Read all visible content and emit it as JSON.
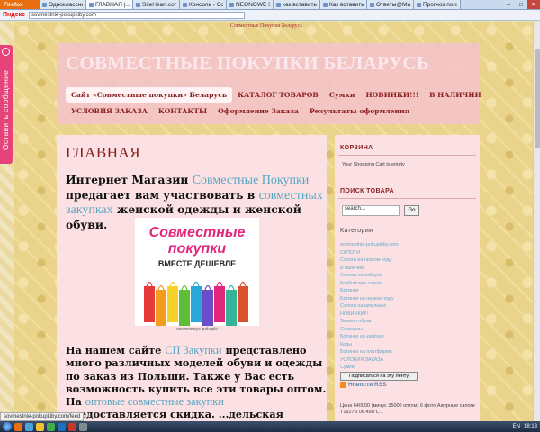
{
  "browser": {
    "firefox_label": "Firefox",
    "tabs": [
      {
        "label": "Одноклассники",
        "active": false
      },
      {
        "label": "ГЛАВНАЯ |...",
        "active": true
      },
      {
        "label": "SiteHeart.com",
        "active": false
      },
      {
        "label": "Консоль › Сов...",
        "active": false
      },
      {
        "label": "NEONOWE SZ...",
        "active": false
      },
      {
        "label": "как вставить к...",
        "active": false
      },
      {
        "label": "Как вставить к...",
        "active": false
      },
      {
        "label": "Ответы@Mail....",
        "active": false
      },
      {
        "label": "Прогноз пого...",
        "active": false
      }
    ],
    "yandex_label": "Яндекс",
    "url": "sovmestnie-pokupkiby.com",
    "window_buttons": [
      "–",
      "□",
      "✕"
    ],
    "status_url": "sovmestnie-pokupkiby.com/feed"
  },
  "share_widget": {
    "label": "Оставить сообщение",
    "icon": "chat-bubble-icon"
  },
  "site": {
    "top_line": "Совместные Покупки Беларусь",
    "title": "СОВМЕСТНЫЕ ПОКУПКИ БЕЛАРУСЬ",
    "menu_row1": [
      "Сайт «Совместные покупки» Беларусь",
      "КАТАЛОГ ТОВАРОВ",
      "Сумки",
      "НОВИНКИ!!!",
      "В НАЛИЧИИ"
    ],
    "menu_row2": [
      "УСЛОВИЯ ЗАКАЗА",
      "КОНТАКТЫ",
      "Оформление Заказа",
      "Результаты оформления"
    ]
  },
  "main": {
    "title": "ГЛАВНАЯ",
    "intro": {
      "t1": "Интернет Магазин ",
      "l1": "Совместные Покупки",
      "t2": " предагает вам участвовать в ",
      "l2": "совместных закупках",
      "t3": " женской одежды и женской обуви."
    },
    "promo": {
      "line1": "Совместные",
      "line2": "покупки",
      "line3": "ВМЕСТЕ ДЕШЕВЛЕ",
      "caption": "sovmestnye-pokupki",
      "bag_colors": [
        "#e63b3b",
        "#f39c1e",
        "#f5d32b",
        "#5cbf3a",
        "#2aa6d8",
        "#6a4fc7",
        "#e2267b",
        "#37b39a",
        "#d8532b"
      ]
    },
    "body": {
      "t1": "На нашем сайте ",
      "l1": "СП Закупки",
      "t2": " представлено много различных моделей обуви и одежды по заказ из Польши. Также у Вас есть возможность купить все эти товары оптом. На ",
      "l2": "оптовые совместные закупки",
      "t3": " предоставляется скидка. ...дельская Женская обувь, которую вы увидите"
    }
  },
  "sidebar": {
    "cart_title": "КОРЗИНА",
    "cart_text": "Your Shopping Cart is empty",
    "search_title": "ПОИСК ТОВАРА",
    "search_value": "search...",
    "search_button": "Go",
    "categories_title": "Категории",
    "categories": [
      "sovmestnie-pokupkiby.com",
      "САПОГИ",
      "Сапоги на низком ходу",
      "В наличии",
      "Сапоги на каблуке",
      "Ковбойские сапоги",
      "Ботинки",
      "Ботинки на низком ходу",
      "Сапоги на шпильках",
      "НОВИНКИ!!!",
      "Зимняя обувь",
      "Сникерсы",
      "Ботинки на каблуке",
      "Кеды",
      "Ботинки на платформе",
      "УСЛОВИЯ ЗАКАЗА",
      "Сумки"
    ],
    "subscribe_button": "Подписаться на эту ленту",
    "rss_title": "Новости RSS",
    "feed_text": "Цена 640000 (минус 35000 оптом) 6 фото Ажурные сапоги T1927B 06.49D L..."
  },
  "taskbar": {
    "lang": "EN",
    "time": "18:13",
    "icon_colors": [
      "#e96e0f",
      "#4aa3df",
      "#f2c230",
      "#3fae49",
      "#1f6fbf",
      "#c0392b",
      "#7f8c8d"
    ]
  }
}
